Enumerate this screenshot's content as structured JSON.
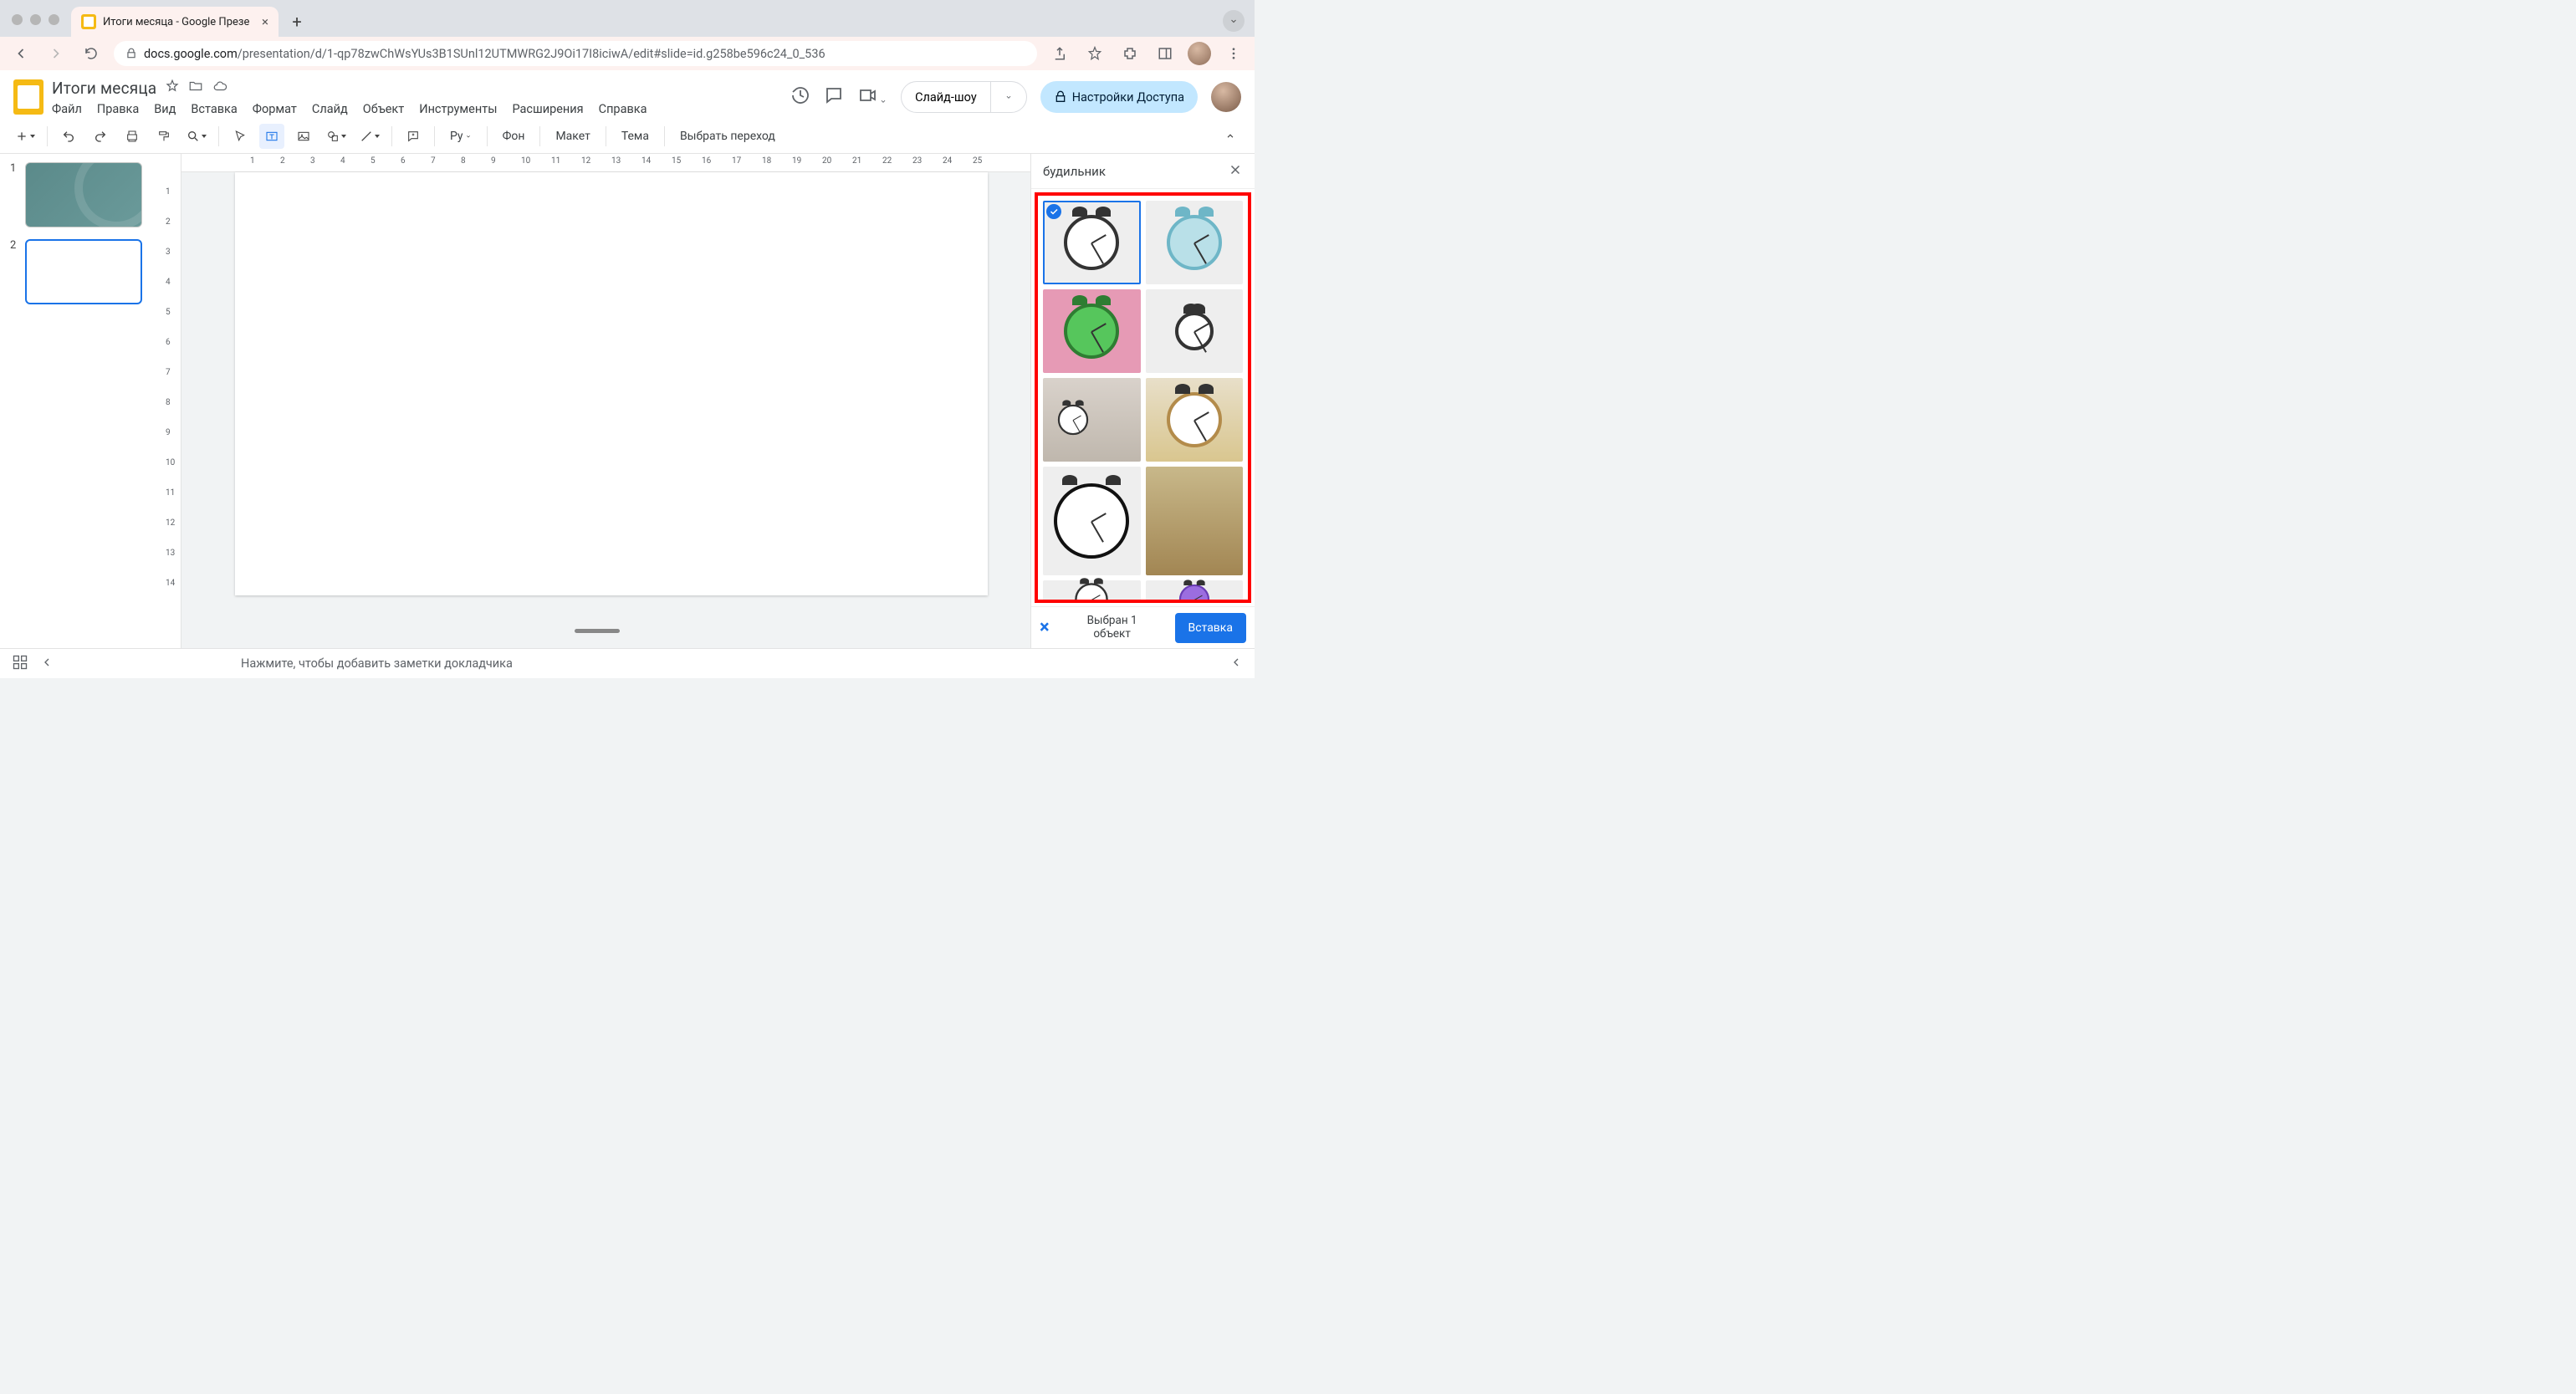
{
  "browser": {
    "tab_title": "Итоги месяца - Google Презе",
    "url_host": "docs.google.com",
    "url_path": "/presentation/d/1-qp78zwChWsYUs3B1SUnl12UTMWRG2J9Oi17I8iciwA/edit#slide=id.g258be596c24_0_536"
  },
  "header": {
    "doc_title": "Итоги месяца",
    "menus": [
      "Файл",
      "Правка",
      "Вид",
      "Вставка",
      "Формат",
      "Слайд",
      "Объект",
      "Инструменты",
      "Расширения",
      "Справка"
    ],
    "slideshow": "Слайд-шоу",
    "share": "Настройки Доступа"
  },
  "toolbar": {
    "paint_format_label": "Ру",
    "bg": "Фон",
    "layout": "Макет",
    "theme": "Тема",
    "transition": "Выбрать переход"
  },
  "ruler_h": [
    "1",
    "2",
    "3",
    "4",
    "5",
    "6",
    "7",
    "8",
    "9",
    "10",
    "11",
    "12",
    "13",
    "14",
    "15",
    "16",
    "17",
    "18",
    "19",
    "20",
    "21",
    "22",
    "23",
    "24",
    "25"
  ],
  "ruler_v": [
    "1",
    "2",
    "3",
    "4",
    "5",
    "6",
    "7",
    "8",
    "9",
    "10",
    "11",
    "12",
    "13",
    "14"
  ],
  "thumbs": [
    {
      "num": "1",
      "selected": false
    },
    {
      "num": "2",
      "selected": true
    }
  ],
  "search": {
    "query": "будильник",
    "selected_count_line1": "Выбран 1",
    "selected_count_line2": "объект",
    "insert": "Вставка",
    "results": [
      {
        "name": "alarm-black",
        "selected": true,
        "variant": "bells"
      },
      {
        "name": "alarm-teal",
        "selected": false,
        "variant": "blue"
      },
      {
        "name": "alarm-green",
        "selected": false,
        "variant": "green"
      },
      {
        "name": "alarm-small-black",
        "selected": false,
        "variant": "small"
      },
      {
        "name": "alarm-room",
        "selected": false,
        "variant": "room"
      },
      {
        "name": "alarm-wood",
        "selected": false,
        "variant": "wood"
      },
      {
        "name": "alarm-lineart",
        "selected": false,
        "variant": "line"
      },
      {
        "name": "poster-vintage",
        "selected": false,
        "variant": "poster"
      },
      {
        "name": "alarm-partial",
        "selected": false,
        "variant": "partial"
      },
      {
        "name": "alarm-purple",
        "selected": false,
        "variant": "purple partial"
      }
    ]
  },
  "bottom": {
    "notes_placeholder": "Нажмите, чтобы добавить заметки докладчика"
  }
}
